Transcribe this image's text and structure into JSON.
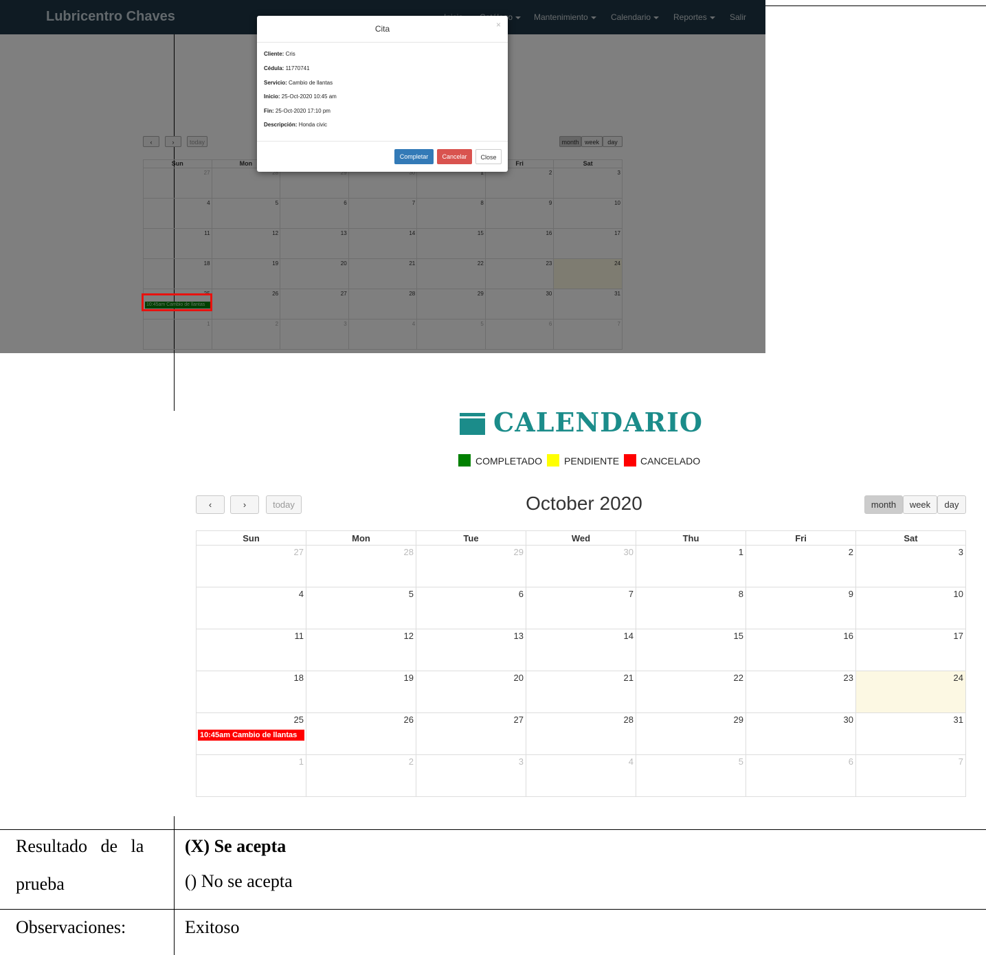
{
  "screenshot1": {
    "brand": "Lubricentro Chaves",
    "nav": [
      "Inicio",
      "Catálogo",
      "Mantenimiento",
      "Calendario",
      "Reportes",
      "Salir"
    ],
    "modal": {
      "title": "Cita",
      "close_glyph": "×",
      "details": [
        {
          "label": "Cliente:",
          "value": "Cris"
        },
        {
          "label": "Cédula:",
          "value": "11770741"
        },
        {
          "label": "Servicio:",
          "value": "Cambio de llantas"
        },
        {
          "label": "Inicio:",
          "value": "25-Oct-2020 10:45 am"
        },
        {
          "label": "Fin:",
          "value": "25-Oct-2020 17:10 pm"
        },
        {
          "label": "Descripción:",
          "value": "Honda civic"
        }
      ],
      "buttons": {
        "complete": "Completar",
        "cancel": "Cancelar",
        "close": "Close"
      }
    },
    "toolbar": {
      "prev": "‹",
      "next": "›",
      "today": "today",
      "month": "month",
      "week": "week",
      "day": "day"
    },
    "event_label": "10:45am Cambio de llantas"
  },
  "calendar": {
    "title": "CALENDARIO",
    "legend": [
      {
        "label": "COMPLETADO",
        "color": "#008000"
      },
      {
        "label": "PENDIENTE",
        "color": "#ffff00"
      },
      {
        "label": "CANCELADO",
        "color": "#ff0000"
      }
    ],
    "toolbar": {
      "prev": "‹",
      "next": "›",
      "today": "today",
      "month": "month",
      "week": "week",
      "day": "day"
    },
    "month_title": "October 2020",
    "weekdays": [
      "Sun",
      "Mon",
      "Tue",
      "Wed",
      "Thu",
      "Fri",
      "Sat"
    ],
    "weeks": [
      [
        "27",
        "28",
        "29",
        "30",
        "1",
        "2",
        "3"
      ],
      [
        "4",
        "5",
        "6",
        "7",
        "8",
        "9",
        "10"
      ],
      [
        "11",
        "12",
        "13",
        "14",
        "15",
        "16",
        "17"
      ],
      [
        "18",
        "19",
        "20",
        "21",
        "22",
        "23",
        "24"
      ],
      [
        "25",
        "26",
        "27",
        "28",
        "29",
        "30",
        "31"
      ],
      [
        "1",
        "2",
        "3",
        "4",
        "5",
        "6",
        "7"
      ]
    ],
    "event": {
      "label": "10:45am Cambio de llantas",
      "color": "#ff0000"
    }
  },
  "document": {
    "result_label_line1": "Resultado   de   la",
    "result_label_line2": "prueba",
    "accept_option": "(X) Se acepta",
    "reject_option": "() No se acepta",
    "observations_label": "Observaciones:",
    "observations_value": "Exitoso"
  }
}
